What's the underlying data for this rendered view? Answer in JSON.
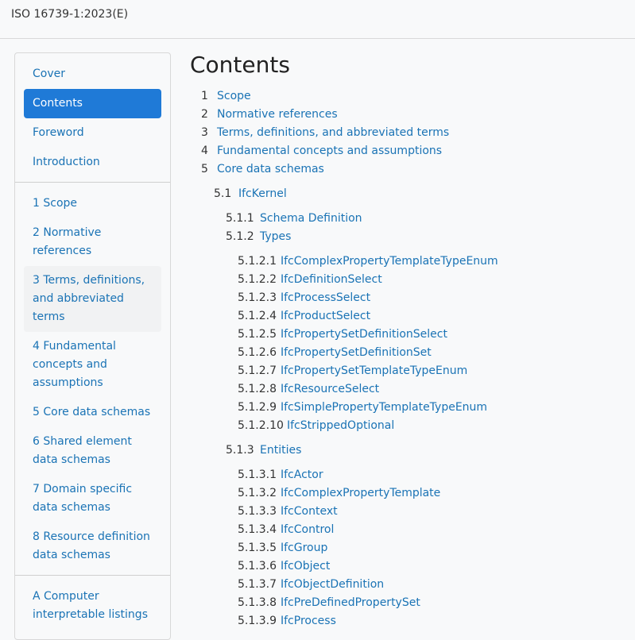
{
  "header": {
    "title": "ISO 16739-1:2023(E)"
  },
  "sidebar": {
    "groups": [
      [
        {
          "label": "Cover"
        },
        {
          "label": "Contents"
        },
        {
          "label": "Foreword"
        },
        {
          "label": "Introduction"
        }
      ],
      [
        {
          "label": "1 Scope"
        },
        {
          "label": "2 Normative references"
        },
        {
          "label": "3 Terms, definitions, and abbreviated terms"
        },
        {
          "label": "4 Fundamental concepts and assumptions"
        },
        {
          "label": "5 Core data schemas"
        },
        {
          "label": "6 Shared element data schemas"
        },
        {
          "label": "7 Domain specific data schemas"
        },
        {
          "label": "8 Resource definition data schemas"
        }
      ],
      [
        {
          "label": "A Computer interpretable listings"
        }
      ]
    ]
  },
  "main": {
    "title": "Contents",
    "toc": [
      {
        "num": "1",
        "label": "Scope"
      },
      {
        "num": "2",
        "label": "Normative references"
      },
      {
        "num": "3",
        "label": "Terms, definitions, and abbreviated terms"
      },
      {
        "num": "4",
        "label": "Fundamental concepts and assumptions"
      },
      {
        "num": "5",
        "label": "Core data schemas"
      },
      {
        "num": "5.1",
        "label": "IfcKernel"
      },
      {
        "num": "5.1.1",
        "label": "Schema Definition"
      },
      {
        "num": "5.1.2",
        "label": "Types"
      },
      {
        "num": "5.1.2.1",
        "label": "IfcComplexPropertyTemplateTypeEnum"
      },
      {
        "num": "5.1.2.2",
        "label": "IfcDefinitionSelect"
      },
      {
        "num": "5.1.2.3",
        "label": "IfcProcessSelect"
      },
      {
        "num": "5.1.2.4",
        "label": "IfcProductSelect"
      },
      {
        "num": "5.1.2.5",
        "label": "IfcPropertySetDefinitionSelect"
      },
      {
        "num": "5.1.2.6",
        "label": "IfcPropertySetDefinitionSet"
      },
      {
        "num": "5.1.2.7",
        "label": "IfcPropertySetTemplateTypeEnum"
      },
      {
        "num": "5.1.2.8",
        "label": "IfcResourceSelect"
      },
      {
        "num": "5.1.2.9",
        "label": "IfcSimplePropertyTemplateTypeEnum"
      },
      {
        "num": "5.1.2.10",
        "label": "IfcStrippedOptional"
      },
      {
        "num": "5.1.3",
        "label": "Entities"
      },
      {
        "num": "5.1.3.1",
        "label": "IfcActor"
      },
      {
        "num": "5.1.3.2",
        "label": "IfcComplexPropertyTemplate"
      },
      {
        "num": "5.1.3.3",
        "label": "IfcContext"
      },
      {
        "num": "5.1.3.4",
        "label": "IfcControl"
      },
      {
        "num": "5.1.3.5",
        "label": "IfcGroup"
      },
      {
        "num": "5.1.3.6",
        "label": "IfcObject"
      },
      {
        "num": "5.1.3.7",
        "label": "IfcObjectDefinition"
      },
      {
        "num": "5.1.3.8",
        "label": "IfcPreDefinedPropertySet"
      },
      {
        "num": "5.1.3.9",
        "label": "IfcProcess"
      }
    ]
  }
}
